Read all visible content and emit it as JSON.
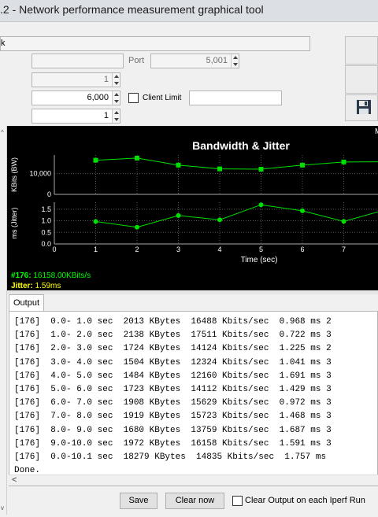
{
  "window": {
    "title": ".2 - Network performance measurement graphical tool"
  },
  "mode_field": {
    "value": "k"
  },
  "port": {
    "label": "Port",
    "value": "5,001"
  },
  "field_a": {
    "value": "1"
  },
  "field_b": {
    "value": "6,000"
  },
  "client_limit": {
    "label": "Client Limit",
    "value": ""
  },
  "field_c": {
    "value": "1"
  },
  "icons": {
    "save": "floppy-disk-icon"
  },
  "colors": {
    "bandwidth": "#00e000",
    "jitter": "#ffff00",
    "chart_bg": "#000000"
  },
  "chart_data": {
    "type": "line",
    "title": "Bandwidth & Jitter",
    "xlabel": "Time (sec)",
    "x": [
      1,
      2,
      3,
      4,
      5,
      6,
      7,
      8
    ],
    "xlim": [
      0,
      8
    ],
    "xticks": [
      "0",
      "1",
      "2",
      "3",
      "4",
      "5",
      "6",
      "7"
    ],
    "panels": [
      {
        "ylabel": "KBits (BW)",
        "yticks": [
          "0",
          "10,000"
        ],
        "ylim": [
          0,
          19000
        ],
        "series": [
          {
            "values": [
              16488,
              17511,
              14124,
              12324,
              12160,
              14112,
              15629,
              15723
            ]
          }
        ]
      },
      {
        "ylabel": "ms (Jitter)",
        "yticks": [
          "0.0",
          "0.5",
          "1.0",
          "1.5"
        ],
        "ylim": [
          0,
          1.8
        ],
        "series": [
          {
            "values": [
              0.968,
              0.722,
              1.225,
              1.041,
              1.691,
              1.429,
              0.972,
              1.468
            ]
          }
        ]
      }
    ],
    "legend": {
      "bandwidth_label": "#176:",
      "bandwidth_value": "16158.00KBits/s",
      "jitter_label": "Jitter:",
      "jitter_value": "1.59ms"
    },
    "corner_label": "M"
  },
  "output": {
    "tab_label": "Output",
    "lines": [
      "[176]  0.0- 1.0 sec  2013 KBytes  16488 Kbits/sec  0.968 ms 2",
      "[176]  1.0- 2.0 sec  2138 KBytes  17511 Kbits/sec  0.722 ms 3",
      "[176]  2.0- 3.0 sec  1724 KBytes  14124 Kbits/sec  1.225 ms 2",
      "[176]  3.0- 4.0 sec  1504 KBytes  12324 Kbits/sec  1.041 ms 3",
      "[176]  4.0- 5.0 sec  1484 KBytes  12160 Kbits/sec  1.691 ms 3",
      "[176]  5.0- 6.0 sec  1723 KBytes  14112 Kbits/sec  1.429 ms 3",
      "[176]  6.0- 7.0 sec  1908 KBytes  15629 Kbits/sec  0.972 ms 3",
      "[176]  7.0- 8.0 sec  1919 KBytes  15723 Kbits/sec  1.468 ms 3",
      "[176]  8.0- 9.0 sec  1680 KBytes  13759 Kbits/sec  1.687 ms 3",
      "[176]  9.0-10.0 sec  1972 KBytes  16158 Kbits/sec  1.591 ms 3",
      "[176]  0.0-10.1 sec  18279 KBytes  14835 Kbits/sec  1.757 ms",
      "Done."
    ]
  },
  "footer": {
    "save_label": "Save",
    "clear_label": "Clear now",
    "clear_each_label": "Clear Output on each Iperf Run"
  }
}
